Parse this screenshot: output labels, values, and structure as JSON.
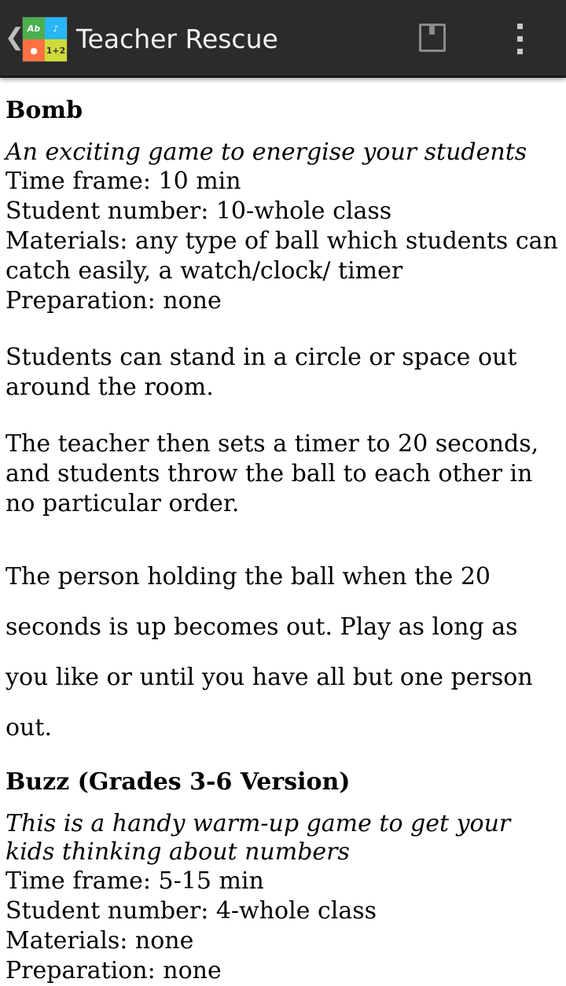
{
  "app": {
    "title": "Teacher Rescue",
    "logo_tiles": [
      "Ab",
      "♪",
      "●",
      "1+2"
    ]
  },
  "icons": {
    "up": "chevron-left-icon",
    "bookmark": "bookmark-icon",
    "overflow": "overflow-menu-icon"
  },
  "content": {
    "sections": [
      {
        "title": "Bomb",
        "subtitle": "An exciting game to energise your students",
        "time_frame": "Time frame: 10 min",
        "student_number": "Student number: 10-whole class",
        "materials": "Materials: any type of ball which students can catch easily, a watch/clock/ timer",
        "preparation": "Preparation: none",
        "paragraphs": [
          "Students can stand in a circle or space out around the room.",
          "The teacher then sets a timer to 20 seconds, and students throw the ball to each other in no particular order.",
          "The person holding the ball when the 20 seconds is up becomes out. Play as long as you like or until you have all but one person out."
        ]
      },
      {
        "title": "Buzz (Grades 3-6 Version)",
        "subtitle": "This is a handy warm-up game to get your kids thinking about numbers",
        "time_frame": "Time frame: 5-15 min",
        "student_number": "Student number: 4-whole class",
        "materials": "Materials: none",
        "preparation": "Preparation: none"
      }
    ]
  }
}
